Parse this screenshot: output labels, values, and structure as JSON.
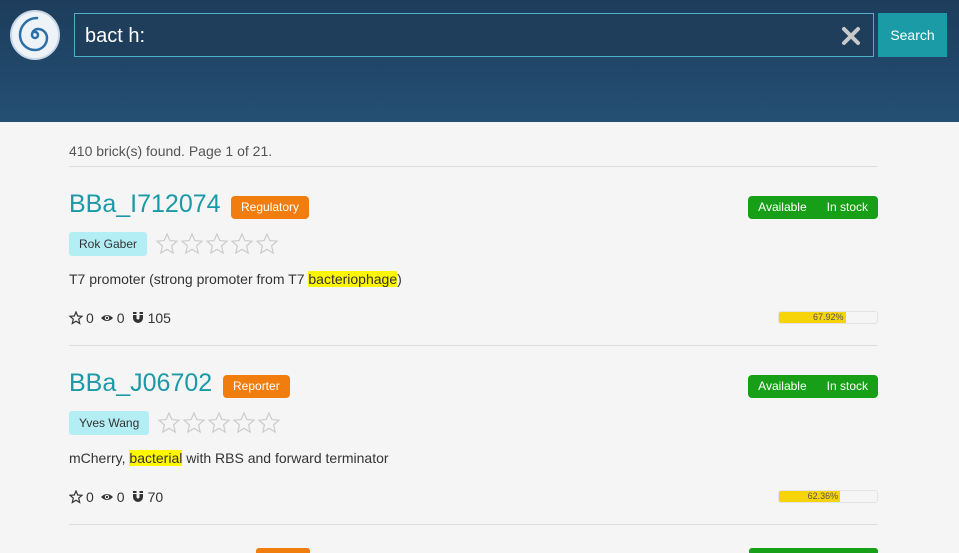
{
  "search": {
    "query": "bact h:",
    "button_label": "Search"
  },
  "summary": "410 brick(s) found. Page 1 of 21.",
  "colors": {
    "header": "#244f74",
    "accent": "#1a9aa6",
    "badge": "#f07d0e",
    "status": "#17a017",
    "progress": "#f7d409",
    "highlight": "#fff700"
  },
  "results": [
    {
      "name": "BBa_I712074",
      "type": "Regulatory",
      "status": [
        "Available",
        "In stock"
      ],
      "author": "Rok Gaber",
      "rating": 0,
      "desc_before": "T7 promoter (strong promoter from T7 ",
      "desc_highlight": "bacteriophage",
      "desc_after": ")",
      "stars": "0",
      "views": "0",
      "uses": "105",
      "progress_label": "67.92%",
      "progress": 67.92
    },
    {
      "name": "BBa_J06702",
      "type": "Reporter",
      "status": [
        "Available",
        "In stock"
      ],
      "author": "Yves Wang",
      "rating": 0,
      "desc_before": "mCherry, ",
      "desc_highlight": "bacterial",
      "desc_after": " with RBS and forward terminator",
      "stars": "0",
      "views": "0",
      "uses": "70",
      "progress_label": "62.36%",
      "progress": 62.36
    }
  ]
}
